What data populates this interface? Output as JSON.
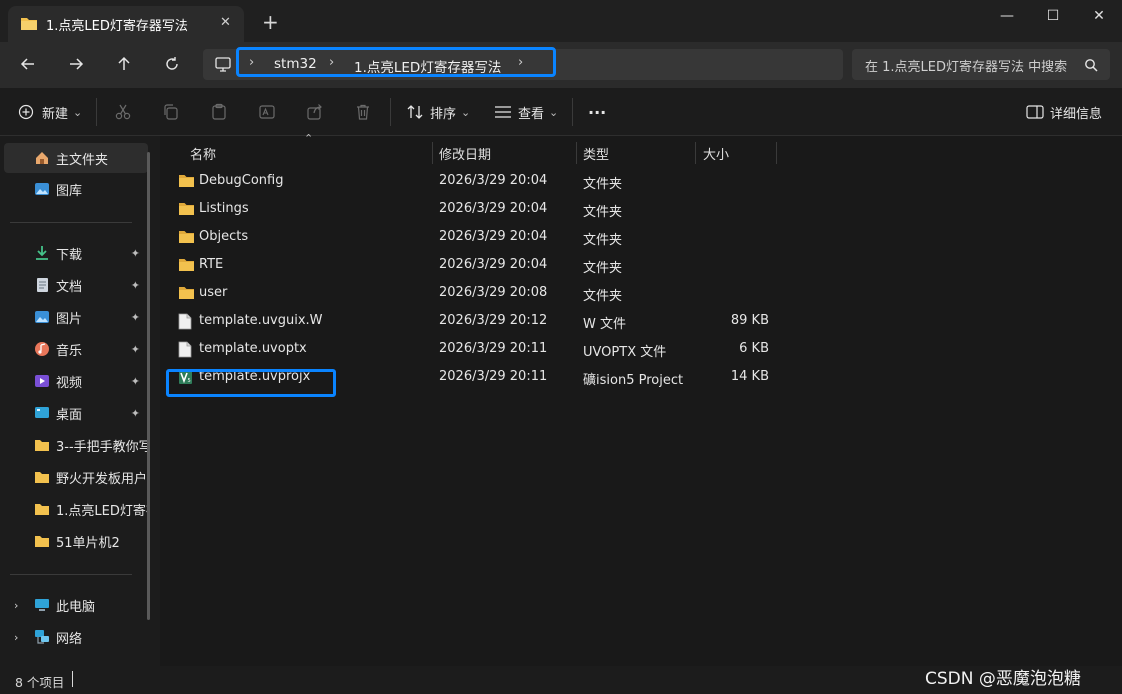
{
  "window": {
    "tab_title": "1.点亮LED灯寄存器写法",
    "tab_close": "✕",
    "new_tab": "+",
    "minimize": "—",
    "maximize": "☐",
    "close": "✕"
  },
  "address": {
    "sep": "›",
    "crumbs": [
      "stm32",
      "1.点亮LED灯寄存器写法"
    ],
    "search_placeholder": "在 1.点亮LED灯寄存器写法 中搜索"
  },
  "toolbar": {
    "new_label": "新建",
    "sort_label": "排序",
    "view_label": "查看",
    "more_label": "···",
    "details_label": "详细信息",
    "dropdown": "⌄"
  },
  "sidebar": {
    "home": "主文件夹",
    "gallery": "图库",
    "pin": "✦",
    "quick": [
      {
        "label": "下载"
      },
      {
        "label": "文档"
      },
      {
        "label": "图片"
      },
      {
        "label": "音乐"
      },
      {
        "label": "视频"
      },
      {
        "label": "桌面"
      },
      {
        "label": "3--手把手教你写"
      },
      {
        "label": "野火开发板用户"
      },
      {
        "label": "1.点亮LED灯寄存"
      },
      {
        "label": "51单片机2"
      }
    ],
    "this_pc": "此电脑",
    "network": "网络",
    "expand": "›"
  },
  "columns": {
    "name": "名称",
    "modified": "修改日期",
    "type": "类型",
    "size": "大小"
  },
  "files": [
    {
      "name": "DebugConfig",
      "modified": "2026/3/29 20:04",
      "type": "文件夹",
      "size": "",
      "kind": "folder"
    },
    {
      "name": "Listings",
      "modified": "2026/3/29 20:04",
      "type": "文件夹",
      "size": "",
      "kind": "folder"
    },
    {
      "name": "Objects",
      "modified": "2026/3/29 20:04",
      "type": "文件夹",
      "size": "",
      "kind": "folder"
    },
    {
      "name": "RTE",
      "modified": "2026/3/29 20:04",
      "type": "文件夹",
      "size": "",
      "kind": "folder"
    },
    {
      "name": "user",
      "modified": "2026/3/29 20:08",
      "type": "文件夹",
      "size": "",
      "kind": "folder"
    },
    {
      "name": "template.uvguix.W",
      "modified": "2026/3/29 20:12",
      "type": "W 文件",
      "size": "89 KB",
      "kind": "file"
    },
    {
      "name": "template.uvoptx",
      "modified": "2026/3/29 20:11",
      "type": "UVOPTX 文件",
      "size": "6 KB",
      "kind": "file"
    },
    {
      "name": "template.uvprojx",
      "modified": "2026/3/29 20:11",
      "type": "礦ision5 Project",
      "size": "14 KB",
      "kind": "keil"
    }
  ],
  "status": {
    "count": "8 个项目"
  },
  "watermark": "CSDN @恶魔泡泡糖",
  "colors": {
    "highlight": "#0a84ff",
    "folder": "#f2c14e",
    "background": "#191919"
  }
}
